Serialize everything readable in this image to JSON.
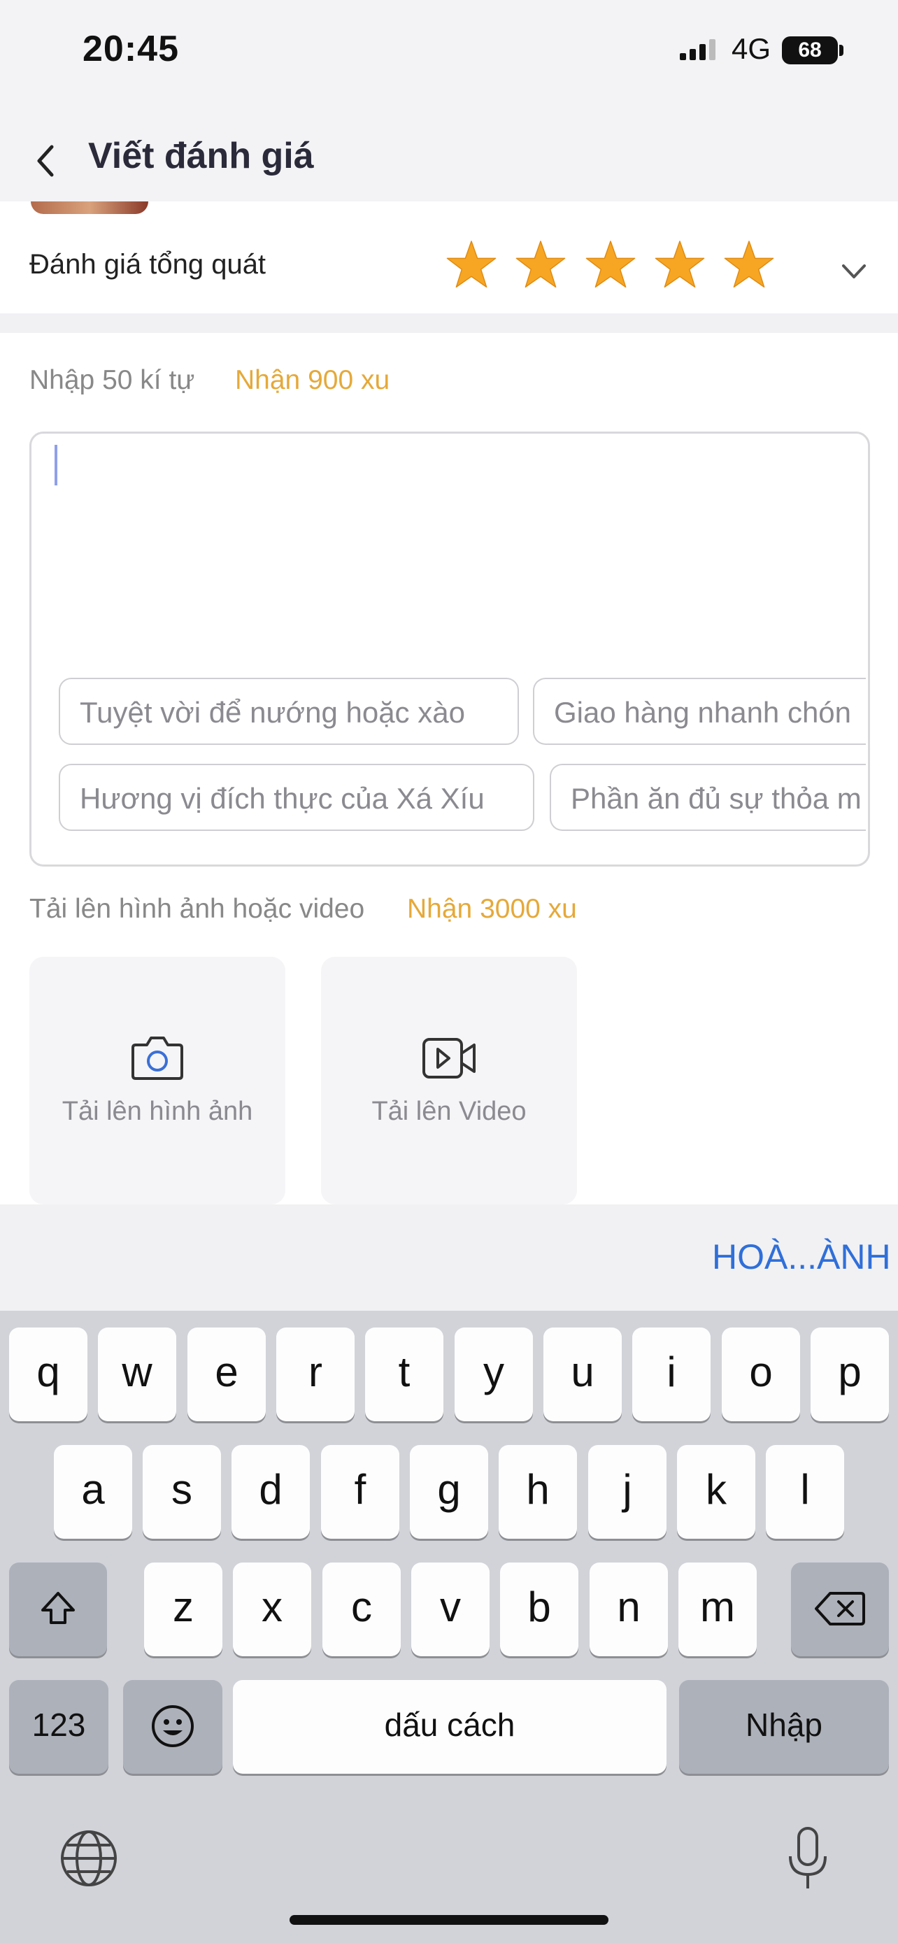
{
  "status_bar": {
    "time": "20:45",
    "network": "4G",
    "battery": "68"
  },
  "header": {
    "title": "Viết đánh giá"
  },
  "rating": {
    "label": "Đánh giá tổng quát",
    "stars": 5,
    "max_stars": 5,
    "star_color": "#f6a623"
  },
  "review": {
    "hint": "Nhập 50 kí tự",
    "reward": "Nhận 900 xu",
    "chips_row1": [
      "Tuyệt vời để nướng hoặc xào",
      "Giao hàng nhanh chón"
    ],
    "chips_row2": [
      "Hương vị đích thực của Xá Xíu",
      "Phần ăn đủ sự thỏa m"
    ]
  },
  "upload": {
    "hint": "Tải lên hình ảnh hoặc video",
    "reward": "Nhận 3000 xu",
    "photo_label": "Tải lên hình ảnh",
    "video_label": "Tải lên Video"
  },
  "keyboard": {
    "done_label": "HOÀ...ÀNH",
    "row1": [
      "q",
      "w",
      "e",
      "r",
      "t",
      "y",
      "u",
      "i",
      "o",
      "p"
    ],
    "row2": [
      "a",
      "s",
      "d",
      "f",
      "g",
      "h",
      "j",
      "k",
      "l"
    ],
    "row3": [
      "z",
      "x",
      "c",
      "v",
      "b",
      "n",
      "m"
    ],
    "numbers_label": "123",
    "space_label": "dấu cách",
    "return_label": "Nhập"
  },
  "colors": {
    "accent_orange": "#e5a93a",
    "link_blue": "#2f6fd9"
  }
}
